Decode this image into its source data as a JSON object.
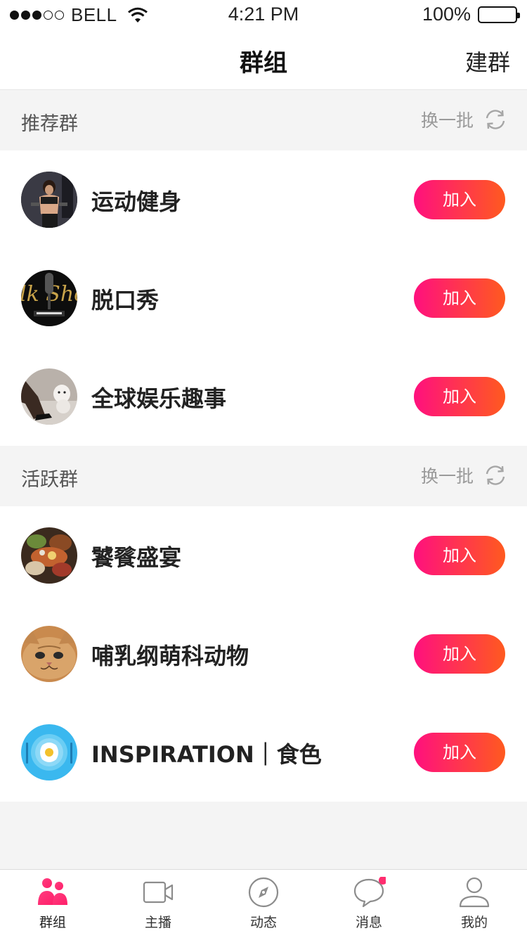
{
  "status_bar": {
    "carrier": "BELL",
    "time": "4:21 PM",
    "battery": "100%",
    "signal_bars_filled": 3,
    "signal_bars_total": 5
  },
  "nav": {
    "title": "群组",
    "action": "建群"
  },
  "sections": [
    {
      "title": "推荐群",
      "refresh_label": "换一批",
      "groups": [
        {
          "name": "运动健身",
          "join_label": "加入"
        },
        {
          "name": "脱口秀",
          "join_label": "加入"
        },
        {
          "name": "全球娱乐趣事",
          "join_label": "加入"
        }
      ]
    },
    {
      "title": "活跃群",
      "refresh_label": "换一批",
      "groups": [
        {
          "name": "饕餮盛宴",
          "join_label": "加入"
        },
        {
          "name": "哺乳纲萌科动物",
          "join_label": "加入"
        },
        {
          "name": "INSPIRATION｜食色",
          "join_label": "加入"
        }
      ]
    }
  ],
  "tabs": [
    {
      "label": "群组",
      "icon": "group-icon",
      "active": true
    },
    {
      "label": "主播",
      "icon": "video-camera-icon",
      "active": false
    },
    {
      "label": "动态",
      "icon": "compass-icon",
      "active": false
    },
    {
      "label": "消息",
      "icon": "chat-bubble-icon",
      "active": false,
      "badge": true
    },
    {
      "label": "我的",
      "icon": "person-icon",
      "active": false
    }
  ],
  "colors": {
    "accent_start": "#ff107e",
    "accent_end": "#ff5a1f",
    "badge": "#ff2d6f"
  }
}
